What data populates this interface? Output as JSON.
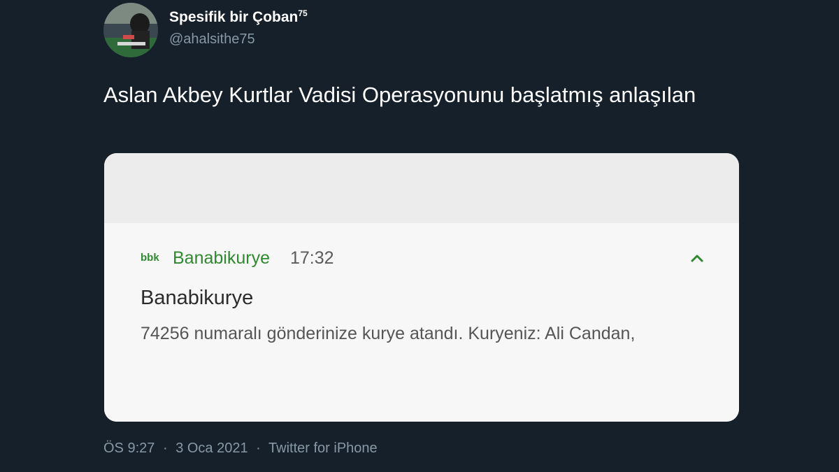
{
  "tweet": {
    "author": {
      "display_name": "Spesifik bir Çoban",
      "display_name_superscript": "75",
      "handle": "@ahalsithe75"
    },
    "text": "Aslan Akbey Kurtlar Vadisi Operasyonunu başlatmış anlaşılan",
    "meta": {
      "time": "ÖS 9:27",
      "date": "3 Oca 2021",
      "separator": "·",
      "source": "Twitter for iPhone"
    }
  },
  "notification": {
    "app_logo_text": "bbk",
    "app_name": "Banabikurye",
    "time": "17:32",
    "title": "Banabikurye",
    "body": "74256 numaralı gönderinize kurye atandı. Kuryeniz: Ali Candan,",
    "accent_color": "#2f8a2f",
    "expand_icon": "chevron-up-icon"
  },
  "theme": {
    "background": "#15202b",
    "secondary_text": "#8899a6"
  }
}
